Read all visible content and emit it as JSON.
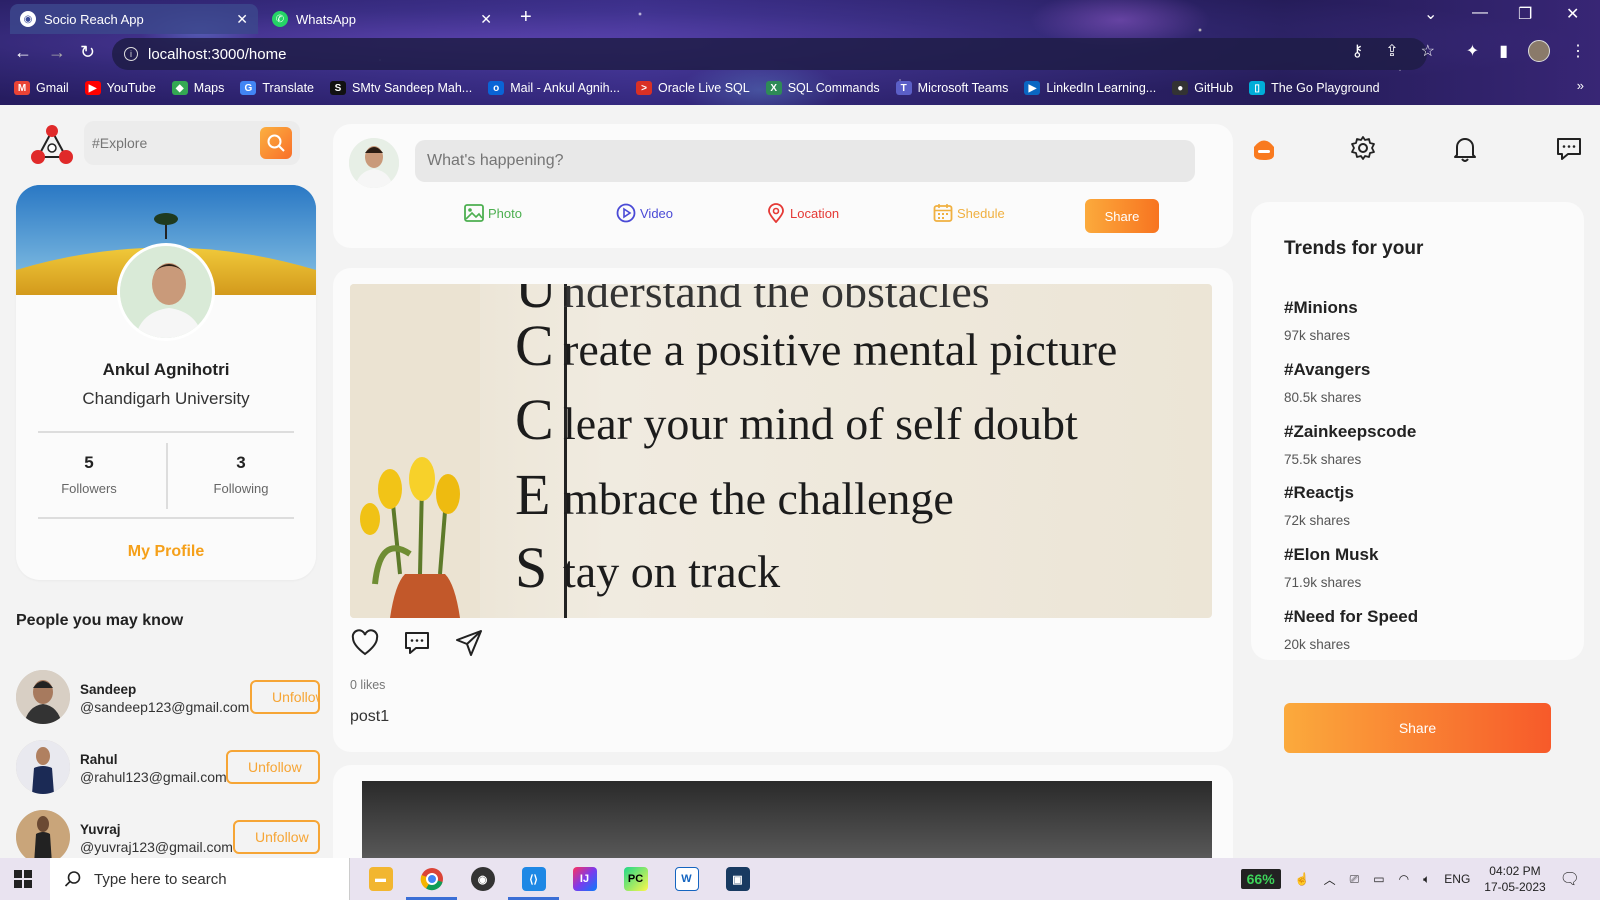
{
  "browser": {
    "tabs": [
      {
        "title": "Socio Reach App",
        "active": true
      },
      {
        "title": "WhatsApp",
        "active": false
      }
    ],
    "url": "localhost:3000/home",
    "bookmarks": [
      {
        "label": "Gmail",
        "color": "#ea4335",
        "glyph": "M"
      },
      {
        "label": "YouTube",
        "color": "#ff0000",
        "glyph": "▶"
      },
      {
        "label": "Maps",
        "color": "#34a853",
        "glyph": "◆"
      },
      {
        "label": "Translate",
        "color": "#4285f4",
        "glyph": "G"
      },
      {
        "label": "SMtv Sandeep Mah...",
        "color": "#111111",
        "glyph": "S"
      },
      {
        "label": "Mail - Ankul Agnih...",
        "color": "#0a64d6",
        "glyph": "o"
      },
      {
        "label": "Oracle Live SQL",
        "color": "#d93025",
        "glyph": ">"
      },
      {
        "label": "SQL Commands",
        "color": "#2e8b57",
        "glyph": "X"
      },
      {
        "label": "Microsoft Teams",
        "color": "#5b5fc7",
        "glyph": "T"
      },
      {
        "label": "LinkedIn Learning...",
        "color": "#0a66c2",
        "glyph": "▶"
      },
      {
        "label": "GitHub",
        "color": "#333333",
        "glyph": "●"
      },
      {
        "label": "The Go Playground",
        "color": "#00add8",
        "glyph": "▯"
      }
    ]
  },
  "search": {
    "placeholder": "#Explore"
  },
  "profile": {
    "name": "Ankul Agnihotri",
    "university": "Chandigarh University",
    "followers_count": "5",
    "followers_label": "Followers",
    "following_count": "3",
    "following_label": "Following",
    "my_profile_label": "My Profile"
  },
  "people": {
    "title": "People you may know",
    "items": [
      {
        "name": "Sandeep",
        "email": "@sandeep123@gmail.com",
        "button": "Unfollow"
      },
      {
        "name": "Rahul",
        "email": "@rahul123@gmail.com",
        "button": "Unfollow"
      },
      {
        "name": "Yuvraj",
        "email": "@yuvraj123@gmail.com",
        "button": "Unfollow"
      }
    ]
  },
  "composer": {
    "placeholder": "What's happening?",
    "options": [
      {
        "label": "Photo",
        "color": "#4caf50",
        "icon": "image-icon"
      },
      {
        "label": "Video",
        "color": "#4a4ad6",
        "icon": "play-icon"
      },
      {
        "label": "Location",
        "color": "#e53935",
        "icon": "location-pin-icon"
      },
      {
        "label": "Shedule",
        "color": "#f0b040",
        "icon": "calendar-icon"
      }
    ],
    "share_label": "Share"
  },
  "post": {
    "image_lines": [
      {
        "letter": "C",
        "text": "reate a positive mental picture"
      },
      {
        "letter": "C",
        "text": "lear your mind of self doubt"
      },
      {
        "letter": "E",
        "text": "mbrace the challenge"
      },
      {
        "letter": "S",
        "text": "tay on track"
      }
    ],
    "likes": "0 likes",
    "caption": "post1"
  },
  "trends": {
    "title": "Trends for your",
    "items": [
      {
        "tag": "#Minions",
        "shares": "97k shares"
      },
      {
        "tag": "#Avangers",
        "shares": "80.5k shares"
      },
      {
        "tag": "#Zainkeepscode",
        "shares": "75.5k shares"
      },
      {
        "tag": "#Reactjs",
        "shares": "72k shares"
      },
      {
        "tag": "#Elon Musk",
        "shares": "71.9k shares"
      },
      {
        "tag": "#Need for Speed",
        "shares": "20k shares"
      }
    ],
    "share_label": "Share"
  },
  "taskbar": {
    "search_placeholder": "Type here to search",
    "battery": "66%",
    "language": "ENG",
    "time": "04:02 PM",
    "date": "17-05-2023"
  },
  "colors": {
    "accent": "#f6a535",
    "accent_dark": "#f87420"
  }
}
